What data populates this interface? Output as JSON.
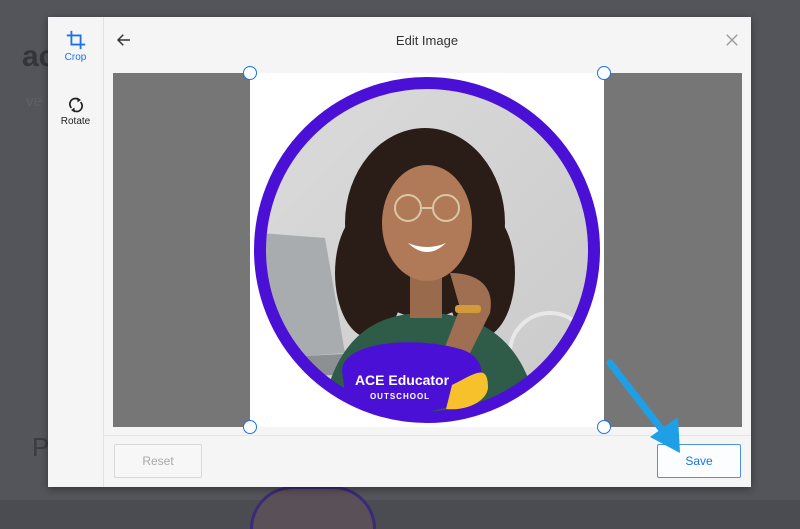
{
  "background": {
    "fragment_heading": "ac",
    "fragment_sub": "ve",
    "fragment_p": "P"
  },
  "sidebar": {
    "tools": [
      {
        "label": "Crop",
        "icon": "crop-icon",
        "active": true
      },
      {
        "label": "Rotate",
        "icon": "rotate-icon",
        "active": false
      }
    ]
  },
  "header": {
    "title": "Edit Image",
    "back_icon": "arrow-left-icon",
    "close_icon": "close-icon"
  },
  "badge": {
    "title": "ACE Educator",
    "subtitle": "OUTSCHOOL"
  },
  "footer": {
    "reset_label": "Reset",
    "save_label": "Save"
  },
  "colors": {
    "accent": "#1a73e8",
    "frame_purple": "#4a10d6",
    "annotation_arrow": "#1fa0e6",
    "badge_yellow": "#f6c12a"
  }
}
